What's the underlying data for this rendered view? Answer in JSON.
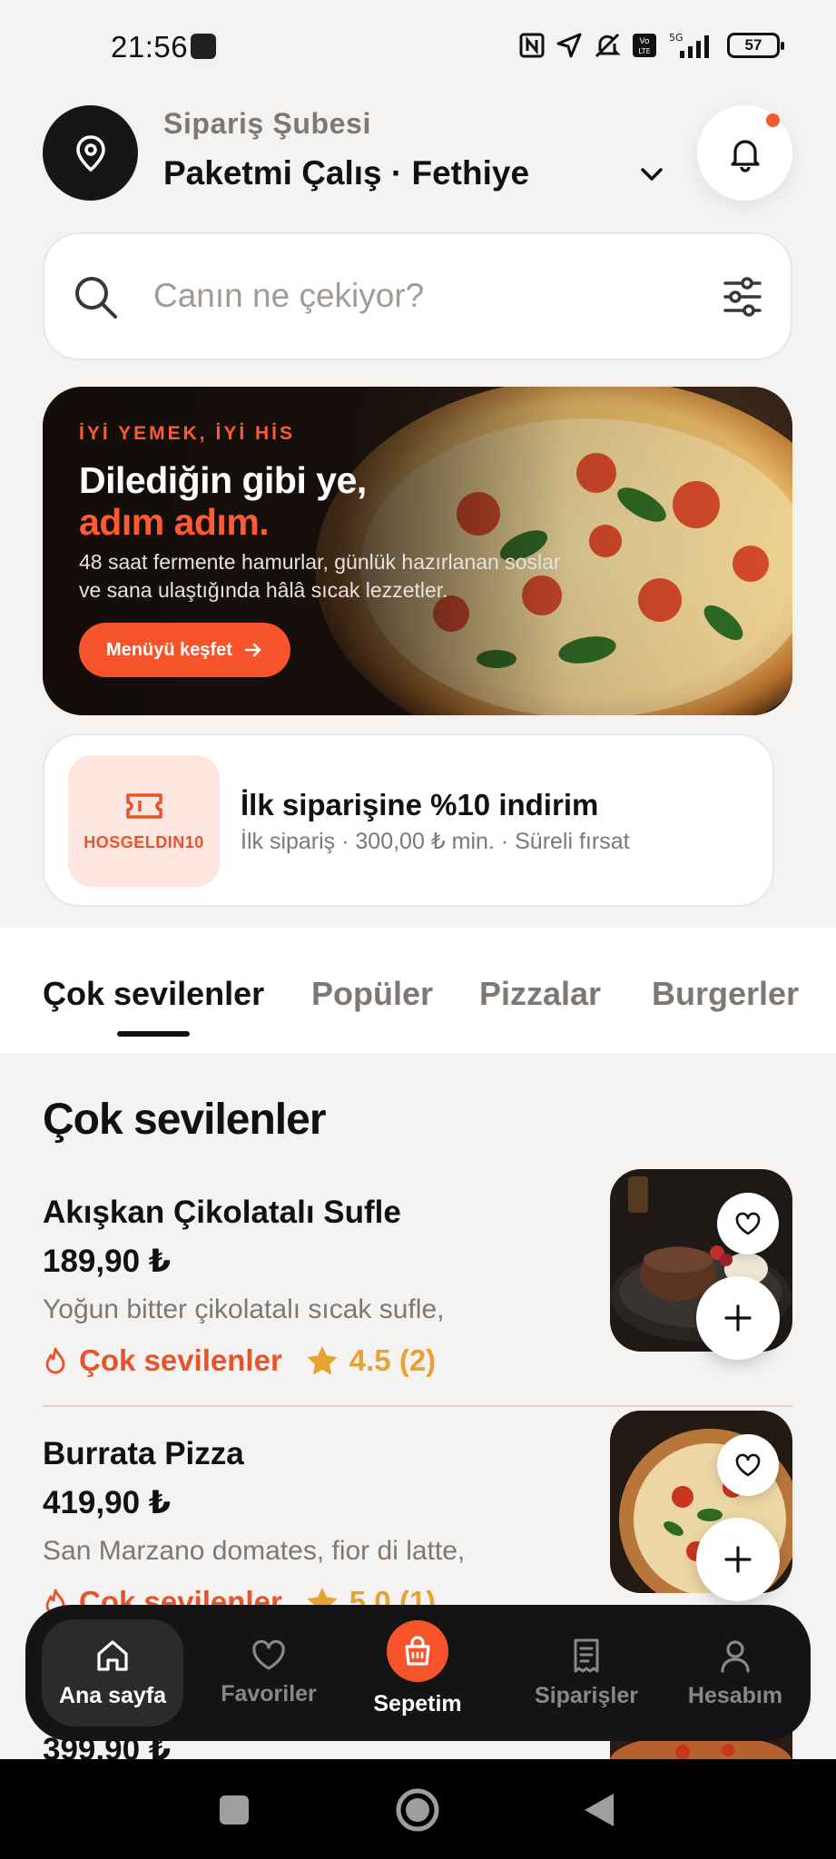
{
  "status_bar": {
    "time": "21:56",
    "battery": "57",
    "network": "5G"
  },
  "header": {
    "label": "Sipariş Şubesi",
    "branch": "Paketmi Çalış · Fethiye",
    "icons": {
      "location": "map-pin-icon",
      "dropdown": "chevron-down-icon",
      "notification": "bell-icon"
    }
  },
  "search": {
    "placeholder": "Canın ne çekiyor?"
  },
  "hero": {
    "eyebrow": "İYİ YEMEK, İYİ HİS",
    "title_line1": "Dilediğin gibi ye,",
    "title_line2": "adım adım.",
    "description": "48 saat fermente hamurlar, günlük hazırlanan soslar ve sana ulaştığında hâlâ sıcak lezzetler.",
    "cta": "Menüyü keşfet"
  },
  "coupon": {
    "code": "HOSGELDIN10",
    "title": "İlk siparişine %10 indirim",
    "subtitle": "İlk sipariş · 300,00 ₺ min. · Süreli fırsat"
  },
  "tabs": [
    {
      "label": "Çok sevilenler",
      "active": true
    },
    {
      "label": "Popüler",
      "active": false
    },
    {
      "label": "Pizzalar",
      "active": false
    },
    {
      "label": "Burgerler",
      "active": false
    }
  ],
  "section": {
    "title": "Çok sevilenler"
  },
  "products": [
    {
      "name": "Akışkan Çikolatalı Sufle",
      "price": "189,90 ₺",
      "description": "Yoğun bitter çikolatalı sıcak sufle,",
      "tag": "Çok sevilenler",
      "rating": "4.5 (2)"
    },
    {
      "name": "Burrata Pizza",
      "price": "419,90 ₺",
      "description": "San Marzano domates, fior di latte,",
      "tag": "Çok sevilenler",
      "rating": "5.0 (1)"
    }
  ],
  "peek_price": "399,90 ₺",
  "bottom_nav": [
    {
      "label": "Ana sayfa",
      "icon": "home-icon",
      "active": true
    },
    {
      "label": "Favoriler",
      "icon": "heart-icon",
      "active": false
    },
    {
      "label": "Sepetim",
      "icon": "shopping-bag-icon",
      "active": false
    },
    {
      "label": "Siparişler",
      "icon": "receipt-icon",
      "active": false
    },
    {
      "label": "Hesabım",
      "icon": "user-icon",
      "active": false
    }
  ],
  "colors": {
    "accent": "#f7542c",
    "dark": "#141414",
    "background": "#f5f3f1",
    "rating": "#e8a233"
  }
}
